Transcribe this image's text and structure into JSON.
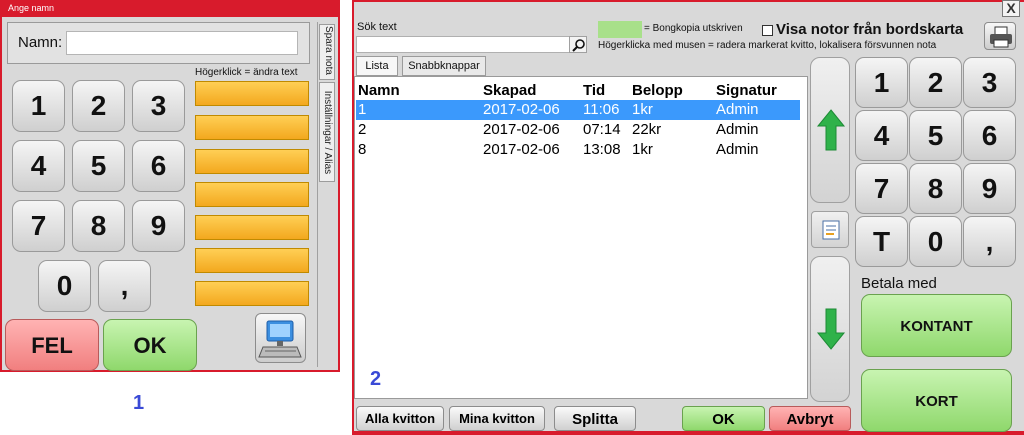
{
  "dialog1": {
    "title": "Ange namn",
    "name_label": "Namn:",
    "name_value": "",
    "hint": "Högerklick = ändra text",
    "keys": [
      "1",
      "2",
      "3",
      "4",
      "5",
      "6",
      "7",
      "8",
      "9",
      "0",
      ","
    ],
    "side_tabs": [
      "Spara nota",
      "Inställningar / Alias"
    ],
    "fel_label": "FEL",
    "ok_label": "OK",
    "caption": "1"
  },
  "dialog2": {
    "search_label": "Sök text",
    "search_value": "",
    "legend_text": "= Bongkopia utskriven",
    "legend_color": "#a8e08a",
    "show_checkbox_label": "Visa notor från bordskarta",
    "hint": "Högerklicka med musen = radera markerat kvitto, lokalisera försvunnen nota",
    "tabs": [
      "Lista",
      "Snabbknappar"
    ],
    "columns": [
      "Namn",
      "Skapad",
      "Tid",
      "Belopp",
      "Signatur"
    ],
    "rows": [
      {
        "namn": "1",
        "skapad": "2017-02-06",
        "tid": "11:06",
        "belopp": "1kr",
        "signatur": "Admin"
      },
      {
        "namn": "2",
        "skapad": "2017-02-06",
        "tid": "07:14",
        "belopp": "22kr",
        "signatur": "Admin"
      },
      {
        "namn": "8",
        "skapad": "2017-02-06",
        "tid": "13:08",
        "belopp": "1kr",
        "signatur": "Admin"
      }
    ],
    "list_caption": "2",
    "bottom_buttons": {
      "all": "Alla kvitton",
      "mine": "Mina kvitton",
      "split": "Splitta",
      "ok": "OK",
      "cancel": "Avbryt"
    },
    "keypad": [
      "1",
      "2",
      "3",
      "4",
      "5",
      "6",
      "7",
      "8",
      "9",
      "T",
      "0",
      ","
    ],
    "pay_with_label": "Betala med",
    "cash_label": "KONTANT",
    "card_label": "KORT",
    "close_symbol": "X",
    "accent": "#d81b2c",
    "selection_color": "#3b99fc"
  },
  "caption_below": "1"
}
